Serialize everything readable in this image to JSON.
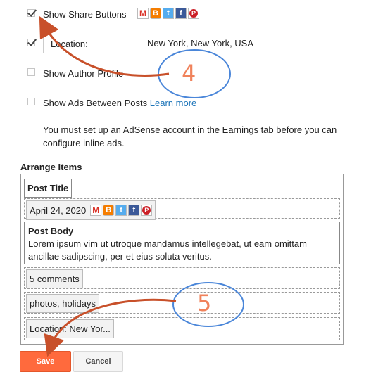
{
  "options": {
    "share_buttons": {
      "label": "Show Share Buttons",
      "checked": true
    },
    "location": {
      "checked": true,
      "field_label": "Location:",
      "value": "New York, New York, USA"
    },
    "author_profile": {
      "label": "Show Author Profile",
      "checked": false
    },
    "ads_between_posts": {
      "label": "Show Ads Between Posts",
      "link": "Learn more",
      "checked": false
    },
    "adsense_note": "You must set up an AdSense account in the Earnings tab before you can configure inline ads."
  },
  "share_icons": [
    "gmail-icon",
    "blogger-icon",
    "twitter-icon",
    "facebook-icon",
    "pinterest-icon"
  ],
  "arrange": {
    "heading": "Arrange Items",
    "post_title": "Post Title",
    "date": "April 24, 2020",
    "post_body_title": "Post Body",
    "post_body_text": "Lorem ipsum vim ut utroque mandamus intellegebat, ut eam omittam ancillae sadipscing, per et eius soluta veritus.",
    "comments": "5 comments",
    "labels": "photos, holidays",
    "location": "Location: New Yor..."
  },
  "buttons": {
    "save": "Save",
    "cancel": "Cancel"
  },
  "callouts": {
    "step4": "4",
    "step5": "5"
  },
  "colors": {
    "accent": "#ff6a3d",
    "callout_circle": "#4a86d9",
    "callout_arrow": "#c8502a",
    "link": "#1a73b8"
  }
}
